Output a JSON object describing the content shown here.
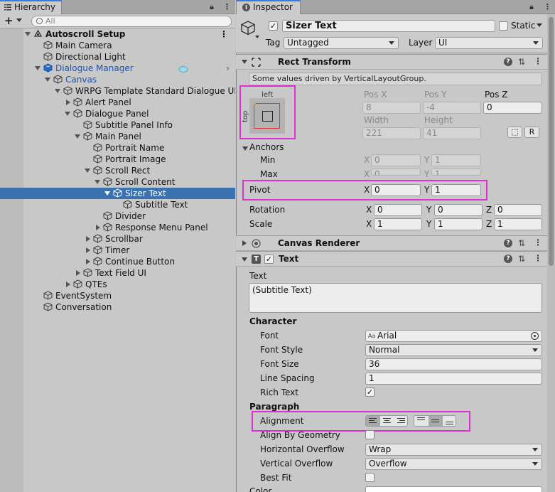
{
  "hierarchy": {
    "tab_label": "Hierarchy",
    "search_placeholder": "All",
    "rows": [
      {
        "label": "Autoscroll Setup",
        "depth": 0,
        "arrow": "down",
        "icon": "unity-scene-icon",
        "bold": true,
        "dots": true
      },
      {
        "label": "Main Camera",
        "depth": 1,
        "arrow": "",
        "icon": "cube-icon"
      },
      {
        "label": "Directional Light",
        "depth": 1,
        "arrow": "",
        "icon": "cube-icon"
      },
      {
        "label": "Dialogue Manager",
        "depth": 1,
        "arrow": "down",
        "icon": "blue-cube-icon",
        "blue": true,
        "chev": true
      },
      {
        "label": "Canvas",
        "depth": 2,
        "arrow": "down",
        "icon": "cube-icon",
        "blue": true
      },
      {
        "label": "WRPG Template Standard Dialogue UI",
        "depth": 3,
        "arrow": "down",
        "icon": "cube-gear-icon"
      },
      {
        "label": "Alert Panel",
        "depth": 4,
        "arrow": "right",
        "icon": "cube-icon"
      },
      {
        "label": "Dialogue Panel",
        "depth": 4,
        "arrow": "down",
        "icon": "cube-icon"
      },
      {
        "label": "Subtitle Panel Info",
        "depth": 5,
        "arrow": "",
        "icon": "cube-icon"
      },
      {
        "label": "Main Panel",
        "depth": 5,
        "arrow": "down",
        "icon": "cube-icon"
      },
      {
        "label": "Portrait Name",
        "depth": 6,
        "arrow": "",
        "icon": "cube-icon"
      },
      {
        "label": "Portrait Image",
        "depth": 6,
        "arrow": "",
        "icon": "cube-icon"
      },
      {
        "label": "Scroll Rect",
        "depth": 6,
        "arrow": "down",
        "icon": "cube-icon"
      },
      {
        "label": "Scroll Content",
        "depth": 7,
        "arrow": "down",
        "icon": "cube-icon"
      },
      {
        "label": "Sizer Text",
        "depth": 8,
        "arrow": "down",
        "icon": "cube-icon",
        "selected": true
      },
      {
        "label": "Subtitle Text",
        "depth": 9,
        "arrow": "",
        "icon": "cube-icon"
      },
      {
        "label": "Divider",
        "depth": 7,
        "arrow": "",
        "icon": "cube-icon"
      },
      {
        "label": "Response Menu Panel",
        "depth": 7,
        "arrow": "right",
        "icon": "cube-icon"
      },
      {
        "label": "Scrollbar",
        "depth": 6,
        "arrow": "right",
        "icon": "cube-icon"
      },
      {
        "label": "Timer",
        "depth": 6,
        "arrow": "right",
        "icon": "cube-icon"
      },
      {
        "label": "Continue Button",
        "depth": 6,
        "arrow": "right",
        "icon": "cube-icon"
      },
      {
        "label": "Text Field UI",
        "depth": 5,
        "arrow": "right",
        "icon": "cube-icon"
      },
      {
        "label": "QTEs",
        "depth": 4,
        "arrow": "right",
        "icon": "cube-icon"
      },
      {
        "label": "EventSystem",
        "depth": 1,
        "arrow": "",
        "icon": "cube-icon"
      },
      {
        "label": "Conversation",
        "depth": 1,
        "arrow": "",
        "icon": "cube-icon"
      }
    ]
  },
  "inspector": {
    "tab_label": "Inspector",
    "object_name": "Sizer Text",
    "static_label": "Static",
    "tag_label": "Tag",
    "tag_value": "Untagged",
    "layer_label": "Layer",
    "layer_value": "UI",
    "rect_transform": {
      "title": "Rect Transform",
      "help": "Some values driven by VerticalLayoutGroup.",
      "anchor_left": "left",
      "anchor_top": "top",
      "posx_label": "Pos X",
      "posx": "8",
      "posy_label": "Pos Y",
      "posy": "-4",
      "posz_label": "Pos Z",
      "posz": "0",
      "width_label": "Width",
      "width": "221",
      "height_label": "Height",
      "height": "41",
      "r_button": "R",
      "anchors_label": "Anchors",
      "min_label": "Min",
      "min_x": "0",
      "min_y": "1",
      "max_label": "Max",
      "max_x": "0",
      "max_y": "1",
      "pivot_label": "Pivot",
      "pivot_x": "0",
      "pivot_y": "1",
      "rotation_label": "Rotation",
      "rot_x": "0",
      "rot_y": "0",
      "rot_z": "0",
      "scale_label": "Scale",
      "scale_x": "1",
      "scale_y": "1",
      "scale_z": "1",
      "x": "X",
      "y": "Y",
      "z": "Z"
    },
    "canvas_renderer": {
      "title": "Canvas Renderer"
    },
    "text": {
      "title": "Text",
      "text_label": "Text",
      "text_value": "(Subtitle Text)",
      "character_label": "Character",
      "font_label": "Font",
      "font_value": "Arial",
      "font_style_label": "Font Style",
      "font_style_value": "Normal",
      "font_size_label": "Font Size",
      "font_size_value": "36",
      "line_spacing_label": "Line Spacing",
      "line_spacing_value": "1",
      "rich_text_label": "Rich Text",
      "paragraph_label": "Paragraph",
      "alignment_label": "Alignment",
      "align_geometry_label": "Align By Geometry",
      "h_overflow_label": "Horizontal Overflow",
      "h_overflow_value": "Wrap",
      "v_overflow_label": "Vertical Overflow",
      "v_overflow_value": "Overflow",
      "best_fit_label": "Best Fit",
      "color_label": "Color"
    }
  }
}
